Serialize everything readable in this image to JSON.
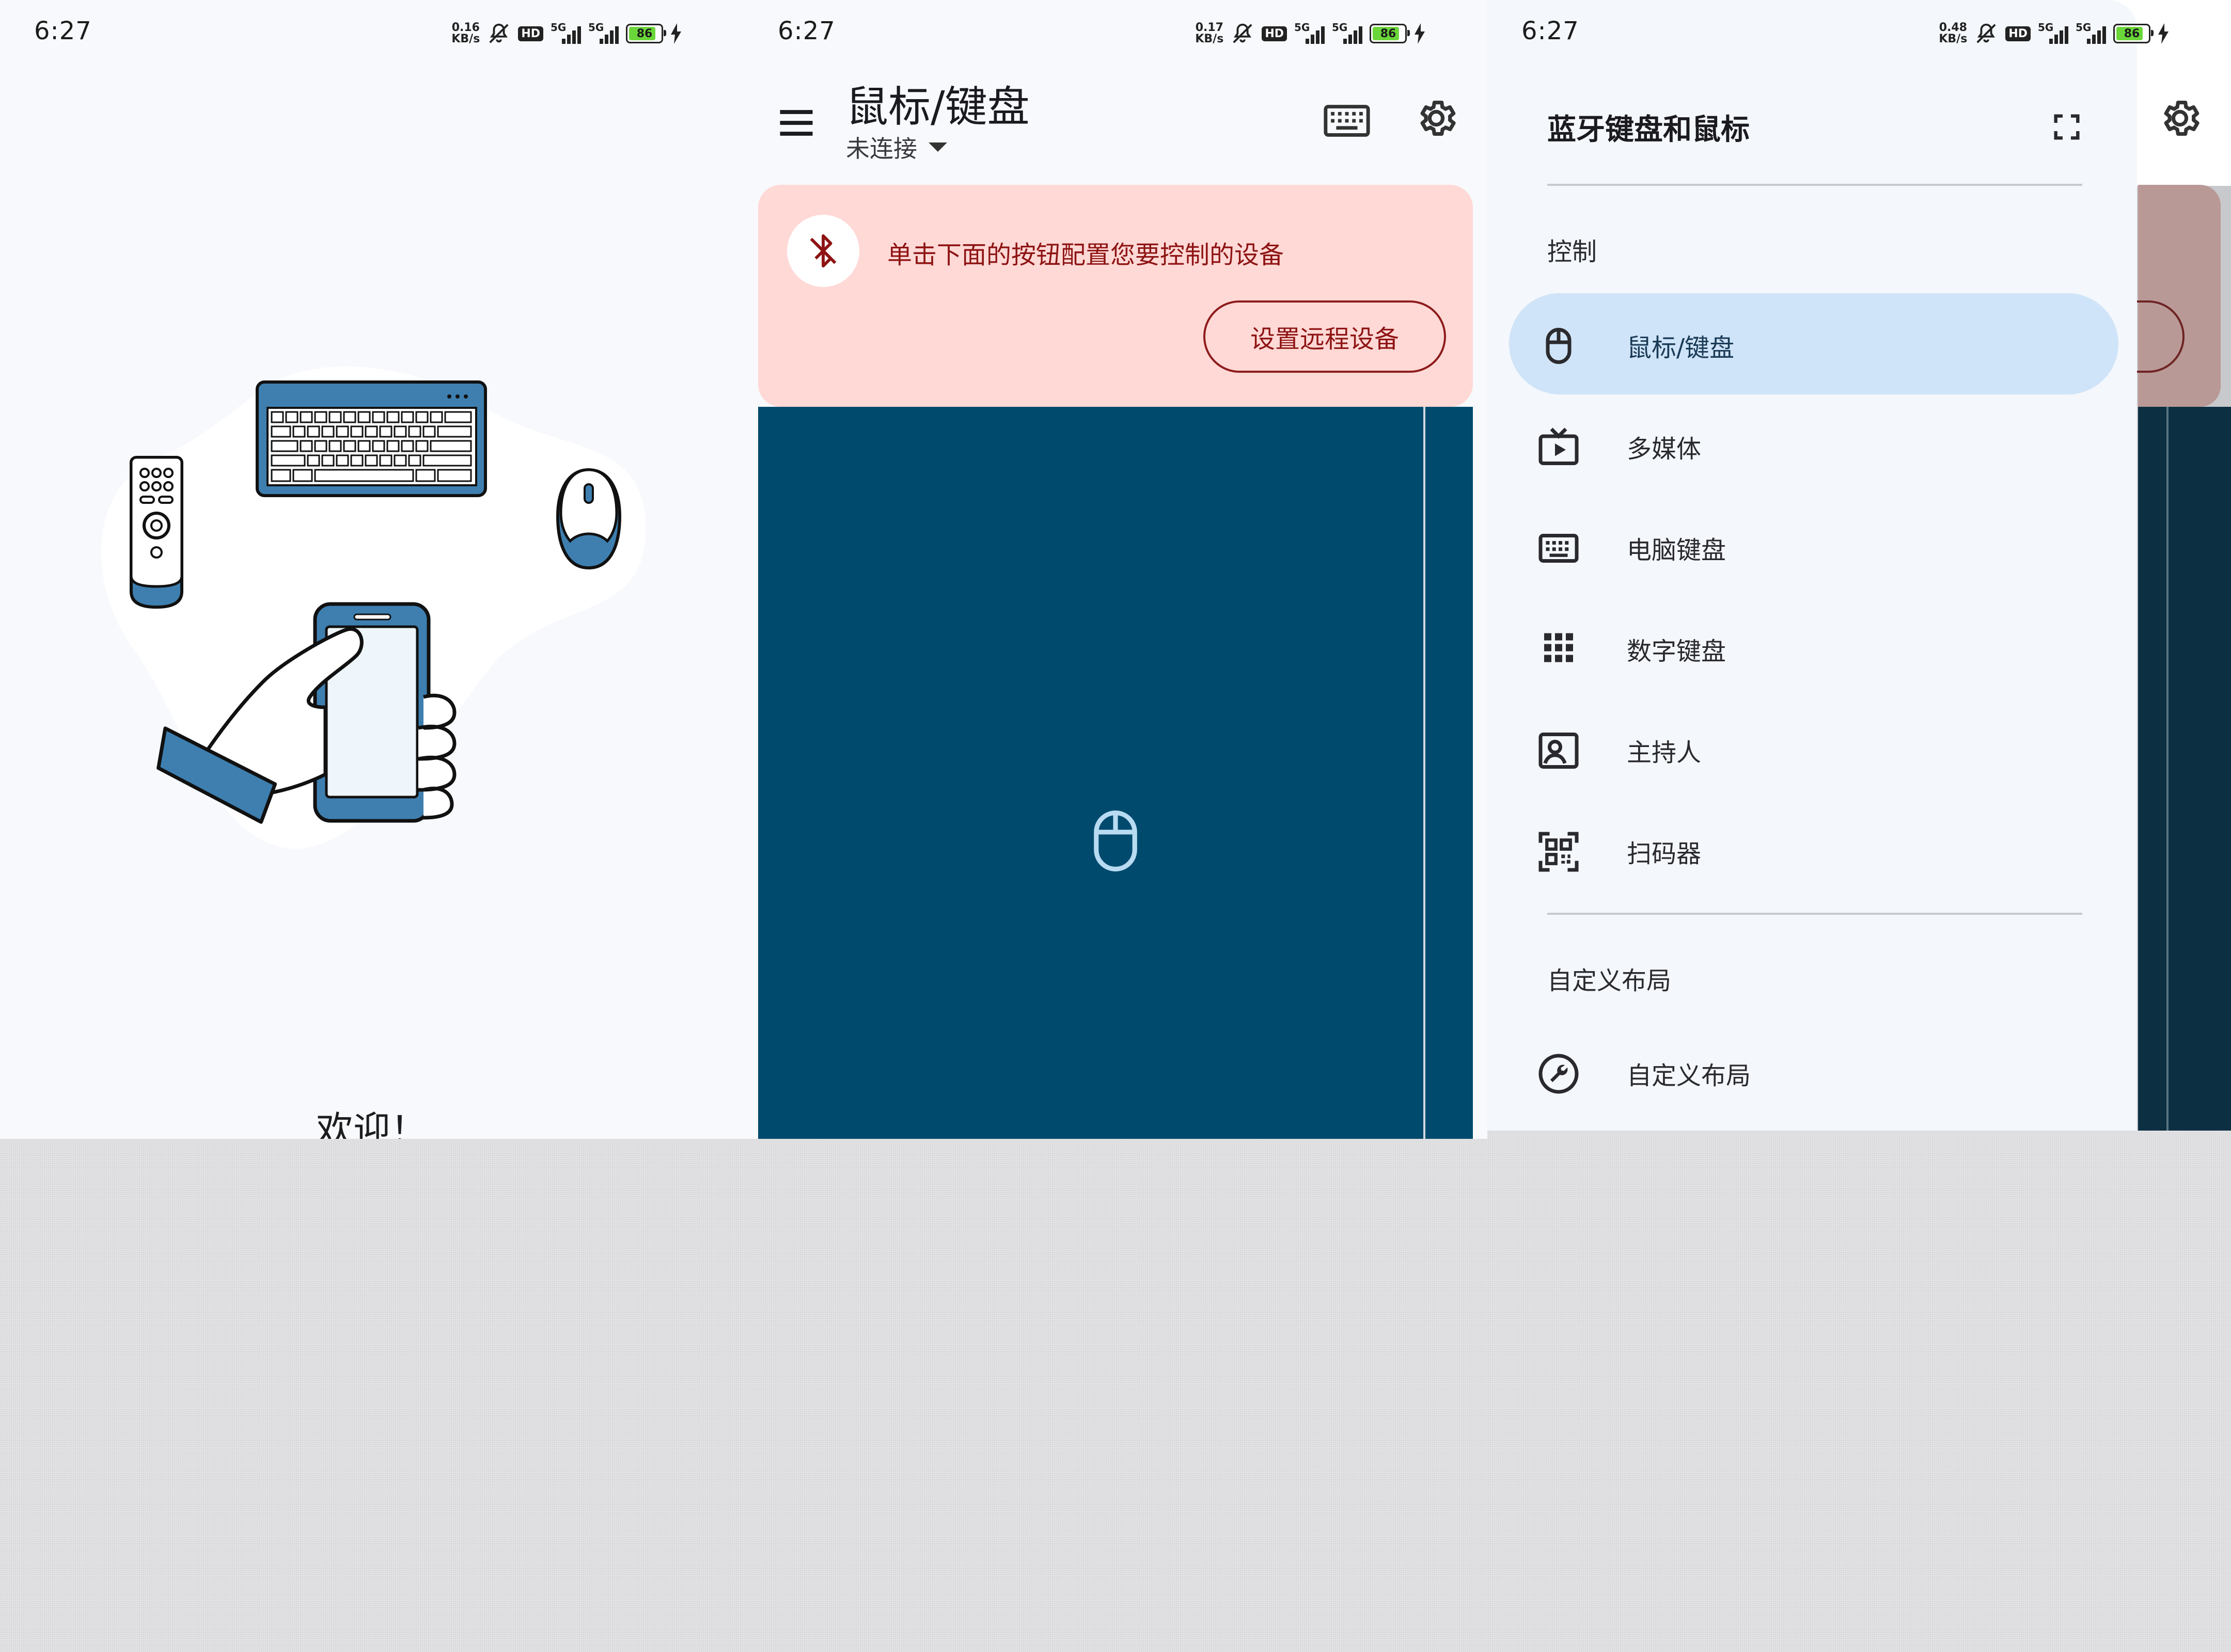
{
  "status_bars": [
    {
      "time": "6:27",
      "net_speed": "0.16",
      "net_unit": "KB/s",
      "hd": "HD",
      "sig1": "5G",
      "sig2": "5G",
      "battery": "86"
    },
    {
      "time": "6:27",
      "net_speed": "0.17",
      "net_unit": "KB/s",
      "hd": "HD",
      "sig1": "5G",
      "sig2": "5G",
      "battery": "86"
    },
    {
      "time": "6:27",
      "net_speed": "0.48",
      "net_unit": "KB/s",
      "hd": "HD",
      "sig1": "5G",
      "sig2": "5G",
      "battery": "86"
    }
  ],
  "welcome": {
    "title": "欢迎！"
  },
  "main": {
    "title": "鼠标/键盘",
    "connection_status": "未连接",
    "banner_message": "单击下面的按钮配置您要控制的设备",
    "setup_button": "设置远程设备"
  },
  "drawer": {
    "title": "蓝牙键盘和鼠标",
    "sections": [
      {
        "label": "控制",
        "items": [
          {
            "label": "鼠标/键盘",
            "icon": "mouse-icon",
            "active": true
          },
          {
            "label": "多媒体",
            "icon": "tv-play-icon",
            "active": false
          },
          {
            "label": "电脑键盘",
            "icon": "keyboard-icon",
            "active": false
          },
          {
            "label": "数字键盘",
            "icon": "numpad-icon",
            "active": false
          },
          {
            "label": "主持人",
            "icon": "presenter-icon",
            "active": false
          },
          {
            "label": "扫码器",
            "icon": "qr-scanner-icon",
            "active": false
          }
        ]
      },
      {
        "label": "自定义布局",
        "items": [
          {
            "label": "自定义布局",
            "icon": "wrench-icon",
            "active": false
          }
        ]
      }
    ]
  },
  "colors": {
    "accent_blue": "#3e7fb0",
    "pad_blue": "#004a6e",
    "banner_bg": "#ffd9d6",
    "banner_text": "#8e1414",
    "drawer_active": "#cfe4f8"
  }
}
